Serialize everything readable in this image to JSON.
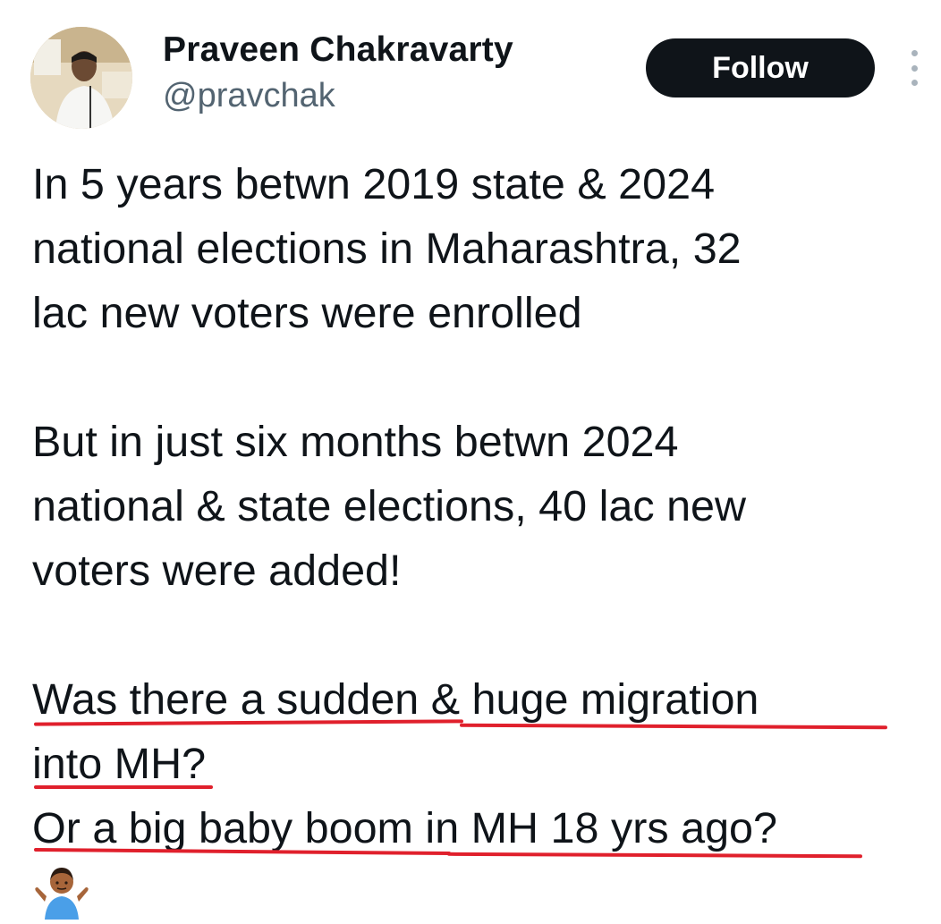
{
  "author": {
    "display_name": "Praveen Chakravarty",
    "handle": "@pravchak"
  },
  "actions": {
    "follow_label": "Follow",
    "more_icon": "more-vertical-icon"
  },
  "tweet": {
    "para1": [
      "In 5 years betwn 2019 state & 2024",
      "national elections in Maharashtra, 32",
      "lac new voters were enrolled"
    ],
    "para2": [
      "But in just six months betwn 2024",
      "national & state elections, 40 lac new",
      "voters were added!"
    ],
    "para3": [
      "Was there a sudden & huge migration",
      "into MH?",
      "Or a big baby boom in MH 18 yrs ago?"
    ],
    "emoji": "person-shrugging-emoji"
  },
  "colors": {
    "follow_bg": "#0f1419",
    "handle": "#536471",
    "underline": "#e0202c"
  }
}
